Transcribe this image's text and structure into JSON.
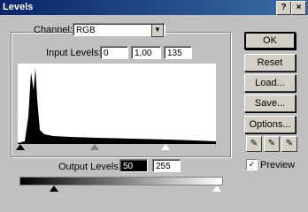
{
  "window": {
    "title": "Levels"
  },
  "channel": {
    "label": "Channel:",
    "value": "RGB"
  },
  "input_levels": {
    "label": "Input Levels:",
    "black": "0",
    "gamma": "1,00",
    "white": "135"
  },
  "output_levels": {
    "label": "Output Levels:",
    "black": "50",
    "white": "255"
  },
  "buttons": {
    "ok": "OK",
    "reset": "Reset",
    "load": "Load...",
    "save": "Save...",
    "options": "Options..."
  },
  "preview": {
    "label": "Preview",
    "checked": true
  }
}
